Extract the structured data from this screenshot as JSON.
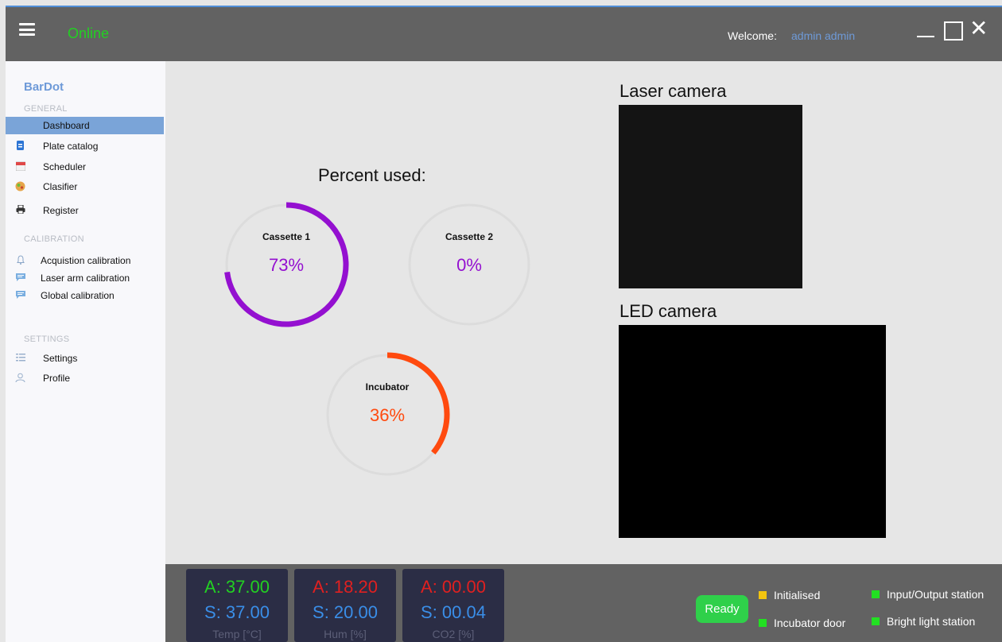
{
  "header": {
    "status": "Online",
    "welcome_label": "Welcome:",
    "username": "admin admin",
    "icons": [
      "hamburger-icon",
      "minimize-icon",
      "maximize-icon",
      "close-icon"
    ]
  },
  "sidebar": {
    "brand": "BarDot",
    "sections": {
      "general": "GENERAL",
      "calibration": "CALIBRATION",
      "settings": "SETTINGS"
    },
    "items": [
      {
        "label": "Dashboard",
        "icon": "none",
        "active": true
      },
      {
        "label": "Plate catalog",
        "icon": "catalog-icon"
      },
      {
        "label": "Scheduler",
        "icon": "calendar-icon"
      },
      {
        "label": "Clasifier",
        "icon": "classifier-icon"
      },
      {
        "label": "Register",
        "icon": "printer-icon"
      },
      {
        "label": "Acquistion calibration",
        "icon": "bell-icon"
      },
      {
        "label": "Laser arm calibration",
        "icon": "message-icon"
      },
      {
        "label": "Global calibration",
        "icon": "message-icon"
      },
      {
        "label": "Settings",
        "icon": "settings-icon"
      },
      {
        "label": "Profile",
        "icon": "profile-icon"
      }
    ]
  },
  "main": {
    "percent_title": "Percent used:",
    "gauges": [
      {
        "name": "Cassette 1",
        "value_text": "73%",
        "fraction": 0.73,
        "color": "#9410d0"
      },
      {
        "name": "Cassette 2",
        "value_text": "0%",
        "fraction": 0.0,
        "color": "#9410d0"
      },
      {
        "name": "Incubator",
        "value_text": "36%",
        "fraction": 0.36,
        "color": "#ff4a0f"
      }
    ],
    "laser_camera_title": "Laser camera",
    "led_camera_title": "LED camera"
  },
  "footer": {
    "sensors": [
      {
        "actual": "A: 37.00",
        "set": "S: 37.00",
        "unit": "Temp [°C]",
        "actual_color": "#22d022"
      },
      {
        "actual": "A: 18.20",
        "set": "S: 20.00",
        "unit": "Hum [%]",
        "actual_color": "#e02020"
      },
      {
        "actual": "A: 00.00",
        "set": "S: 00.04",
        "unit": "CO2 [%]",
        "actual_color": "#e02020"
      }
    ],
    "ready_label": "Ready",
    "statuses": [
      {
        "label": "Initialised",
        "color": "#f2c40f"
      },
      {
        "label": "Incubator door",
        "color": "#22e022"
      },
      {
        "label": "Input/Output station",
        "color": "#22e022"
      },
      {
        "label": "Bright light station",
        "color": "#22e022"
      }
    ]
  },
  "colors": {
    "accent": "#6e9ad8",
    "online": "#22d022",
    "bar_bg": "#626262"
  }
}
